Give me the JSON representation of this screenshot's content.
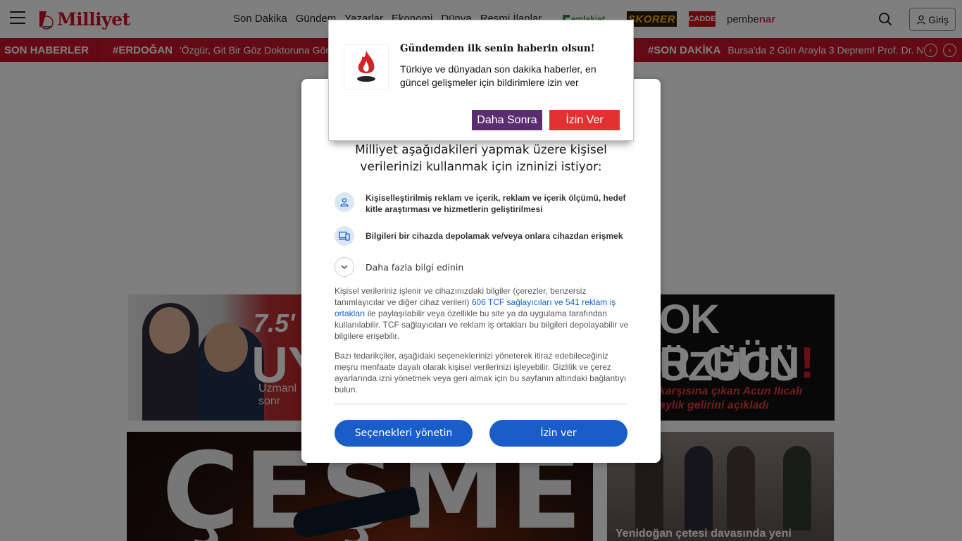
{
  "header": {
    "logo_text": "Milliyet",
    "nav": [
      "Son Dakika",
      "Gündem",
      "Yazarlar",
      "Ekonomi",
      "Dünya",
      "Resmi İlanlar"
    ],
    "brands": [
      "emlakjet",
      "SKORER",
      "CADDE",
      "pembe",
      "nar"
    ],
    "login_label": "Giriş"
  },
  "ticker": {
    "label": "SON HABERLER",
    "items": [
      {
        "tag": "#ERDOĞAN",
        "text": "'Özgür, Git Bir Göz Doktoruna Gör"
      },
      {
        "tag": "#SON DAKİKA",
        "text": "Bursa'da 2 Gün Arayla 3 Deprem! Prof. Dr. N"
      }
    ],
    "prev": "‹",
    "next": "›"
  },
  "cards": {
    "card1": {
      "headline": "7.5'",
      "big": "UY",
      "sub1": "Uzmanl",
      "sub2": "sonr"
    },
    "card2": {
      "line1": "OK ÜZÜCÜ",
      "line2_a": "R GÜN",
      "line2_b": "!",
      "line3": "karşısına çıkan Acun Ilıcalı",
      "line4": "aylık gelirini açıkladı"
    },
    "card3": {
      "big": "ÇEŞME"
    },
    "card4": {
      "caption": "Yenidoğan çetesi davasında yeni"
    }
  },
  "consent": {
    "title": "Milliyet aşağıdakileri yapmak üzere kişisel verilerinizi kullanmak için izninizi istiyor:",
    "purposes": [
      {
        "icon": "person-icon",
        "text": "Kişiselleştirilmiş reklam ve içerik, reklam ve içerik ölçümü, hedef kitle araştırması ve hizmetlerin geliştirilmesi"
      },
      {
        "icon": "devices-icon",
        "text": "Bilgileri bir cihazda depolamak ve/veya onlara cihazdan erişmek"
      }
    ],
    "more_label": "Daha fazla bilgi edinin",
    "para1_a": "Kişisel verileriniz işlenir ve cihazınızdaki bilgiler (çerezler, benzersiz tanımlayıcılar ve diğer cihaz verileri) ",
    "para1_link": "606 TCF sağlayıcıları ve 541 reklam iş ortakları",
    "para1_b": " ile paylaşılabilir veya özellikle bu site ya da uygulama tarafından kullanılabilir. TCF sağlayıcıları ve reklam iş ortakları bu bilgileri depolayabilir ve bilgilere erişebilir.",
    "para2": "Bazı tedarikçiler, aşağıdaki seçeneklerinizi yöneterek itiraz edebileceğiniz meşru menfaate dayalı olarak kişisel verilerinizi işleyebilir. Gizlilik ve çerez ayarlarında izni yönetmek veya geri almak için bu sayfanın altındaki bağlantıyı bulun.",
    "manage_label": "Seçenekleri yönetin",
    "accept_label": "İzin ver",
    "accent": "#1a5cc8"
  },
  "push": {
    "title": "Gündemden ilk senin haberin olsun!",
    "body": "Türkiye ve dünyadan son dakika haberler, en güncel gelişmeler için bildirimlere izin ver",
    "later_label": "Daha Sonra",
    "allow_label": "İzin Ver",
    "later_color": "#5a2d6e",
    "allow_color": "#e33030"
  },
  "colors": {
    "brand_red": "#c8152a"
  }
}
